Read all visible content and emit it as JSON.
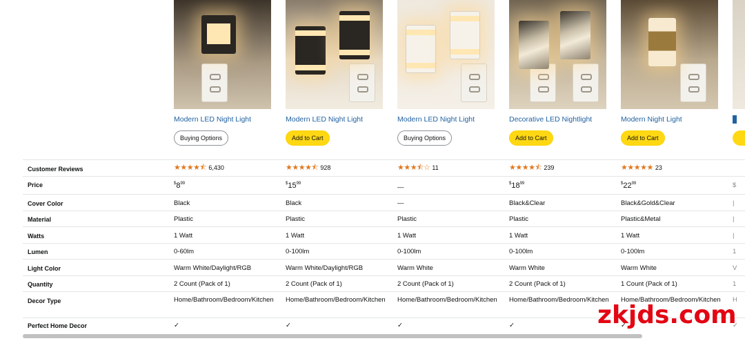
{
  "products": [
    {
      "title": "Modern LED Night Light",
      "button": "Buying Options",
      "button_style": "outline"
    },
    {
      "title": "Modern LED Night Light",
      "button": "Add to Cart",
      "button_style": "cart"
    },
    {
      "title": "Modern LED Night Light",
      "button": "Buying Options",
      "button_style": "outline"
    },
    {
      "title": "Decorative LED Nightlight",
      "button": "Add to Cart",
      "button_style": "cart"
    },
    {
      "title": "Modern Night Light",
      "button": "Add to Cart",
      "button_style": "cart"
    }
  ],
  "rows": {
    "customer_reviews": {
      "label": "Customer Reviews",
      "values": [
        {
          "stars": "★★★★⯪",
          "rating": 4.5,
          "count": "6,430"
        },
        {
          "stars": "★★★★⯪",
          "rating": 4.5,
          "count": "928"
        },
        {
          "stars": "★★★⯪☆",
          "rating": 3.5,
          "count": "11"
        },
        {
          "stars": "★★★★⯪",
          "rating": 4.5,
          "count": "239"
        },
        {
          "stars": "★★★★★",
          "rating": 5,
          "count": "23"
        }
      ]
    },
    "price": {
      "label": "Price",
      "values": [
        {
          "symbol": "$",
          "whole": "8",
          "fraction": "99",
          "text": ""
        },
        {
          "symbol": "$",
          "whole": "15",
          "fraction": "99",
          "text": ""
        },
        {
          "symbol": "",
          "whole": "",
          "fraction": "",
          "text": "—"
        },
        {
          "symbol": "$",
          "whole": "18",
          "fraction": "99",
          "text": ""
        },
        {
          "symbol": "$",
          "whole": "22",
          "fraction": "99",
          "text": ""
        }
      ]
    },
    "cover_color": {
      "label": "Cover Color",
      "values": [
        "Black",
        "Black",
        "—",
        "Black&Clear",
        "Black&Gold&Clear"
      ]
    },
    "material": {
      "label": "Material",
      "values": [
        "Plastic",
        "Plastic",
        "Plastic",
        "Plastic",
        "Plastic&Metal"
      ]
    },
    "watts": {
      "label": "Watts",
      "values": [
        "1 Watt",
        "1 Watt",
        "1 Watt",
        "1 Watt",
        "1 Watt"
      ]
    },
    "lumen": {
      "label": "Lumen",
      "values": [
        "0-60lm",
        "0-100lm",
        "0-100lm",
        "0-100lm",
        "0-100lm"
      ]
    },
    "light_color": {
      "label": "Light Color",
      "values": [
        "Warm White/Daylight/RGB",
        "Warm White/Daylight/RGB",
        "Warm White",
        "Warm White",
        "Warm White"
      ]
    },
    "quantity": {
      "label": "Quantity",
      "values": [
        "2 Count (Pack of 1)",
        "2 Count (Pack of 1)",
        "2 Count (Pack of 1)",
        "2 Count (Pack of 1)",
        "1 Count (Pack of 1)"
      ]
    },
    "decor_type": {
      "label": "Decor Type",
      "values": [
        "Home/Bathroom/Bedroom/Kitchen",
        "Home/Bathroom/Bedroom/Kitchen",
        "Home/Bathroom/Bedroom/Kitchen",
        "Home/Bathroom/Bedroom/Kitchen",
        "Home/Bathroom/Bedroom/Kitchen"
      ]
    },
    "perfect_home_decor": {
      "label": "Perfect Home Decor",
      "values": [
        "✓",
        "✓",
        "✓",
        "✓",
        "✓"
      ]
    }
  },
  "partial_column_stubs": [
    "$",
    "|",
    "|",
    "|",
    "1",
    "(",
    "V",
    "1",
    "H",
    "✓"
  ],
  "watermark": "zkjds.com",
  "colors": {
    "link": "#2162a1",
    "cart_button": "#ffd814",
    "star": "#de7921",
    "watermark": "#e30613"
  }
}
